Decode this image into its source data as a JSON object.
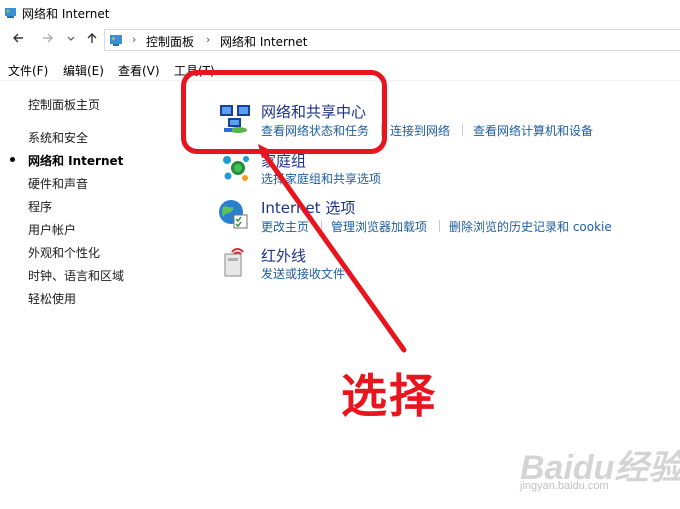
{
  "window": {
    "title": "网络和 Internet"
  },
  "nav": {
    "back_icon": "arrow-left-icon",
    "forward_icon": "arrow-right-icon",
    "dropdown_icon": "chevron-down-icon",
    "up_icon": "arrow-up-icon",
    "breadcrumb": [
      "控制面板",
      "网络和 Internet"
    ]
  },
  "menu": {
    "items": [
      "文件(F)",
      "编辑(E)",
      "查看(V)",
      "工具(T)"
    ]
  },
  "sidebar": {
    "home": "控制面板主页",
    "items": [
      "系统和安全",
      "网络和 Internet",
      "硬件和声音",
      "程序",
      "用户帐户",
      "外观和个性化",
      "时钟、语言和区域",
      "轻松使用"
    ],
    "active_index": 1
  },
  "categories": [
    {
      "title": "网络和共享中心",
      "icon": "network-sharing-center-icon",
      "links": [
        "查看网络状态和任务",
        "连接到网络",
        "查看网络计算机和设备"
      ]
    },
    {
      "title": "家庭组",
      "icon": "homegroup-icon",
      "links": [
        "选择家庭组和共享选项"
      ]
    },
    {
      "title": "Internet 选项",
      "icon": "internet-options-icon",
      "links": [
        "更改主页",
        "管理浏览器加载项",
        "删除浏览的历史记录和 cookie"
      ]
    },
    {
      "title": "红外线",
      "icon": "infrared-icon",
      "links": [
        "发送或接收文件"
      ]
    }
  ],
  "annotation": {
    "text": "选择",
    "color": "#e8141e"
  },
  "watermark": {
    "logo": "Baidu经验",
    "url": "jingyan.baidu.com"
  },
  "colors": {
    "title_link": "#1e3287",
    "task_link": "#1c5d9f",
    "annotation": "#e8141e"
  }
}
